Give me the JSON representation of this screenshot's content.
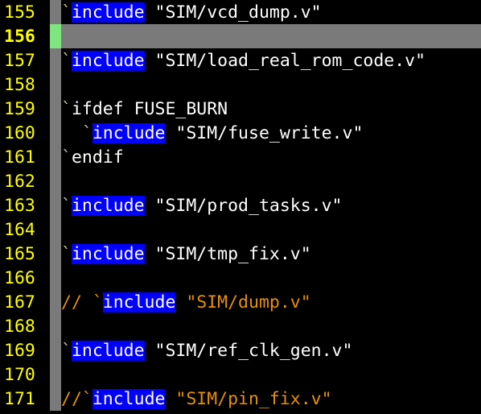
{
  "editor": {
    "lines": [
      {
        "num": "155",
        "segments": [
          {
            "t": "`",
            "c": "tick"
          },
          {
            "t": "include",
            "c": "kw-hl"
          },
          {
            "t": " \"SIM/vcd_dump.v\"",
            "c": "str"
          }
        ]
      },
      {
        "num": "156",
        "current": true,
        "segments": []
      },
      {
        "num": "157",
        "segments": [
          {
            "t": "`",
            "c": "tick"
          },
          {
            "t": "include",
            "c": "kw-hl"
          },
          {
            "t": " \"SIM/load_real_rom_code.v\"",
            "c": "str"
          }
        ]
      },
      {
        "num": "158",
        "segments": []
      },
      {
        "num": "159",
        "segments": [
          {
            "t": "`",
            "c": "tick"
          },
          {
            "t": "ifdef FUSE_BURN",
            "c": "str"
          }
        ]
      },
      {
        "num": "160",
        "segments": [
          {
            "t": "  `",
            "c": "tick"
          },
          {
            "t": "include",
            "c": "kw-hl"
          },
          {
            "t": " \"SIM/fuse_write.v\"",
            "c": "str"
          }
        ]
      },
      {
        "num": "161",
        "segments": [
          {
            "t": "`",
            "c": "tick"
          },
          {
            "t": "endif",
            "c": "str"
          }
        ]
      },
      {
        "num": "162",
        "segments": []
      },
      {
        "num": "163",
        "segments": [
          {
            "t": "`",
            "c": "tick"
          },
          {
            "t": "include",
            "c": "kw-hl"
          },
          {
            "t": " \"SIM/prod_tasks.v\"",
            "c": "str"
          }
        ]
      },
      {
        "num": "164",
        "segments": []
      },
      {
        "num": "165",
        "segments": [
          {
            "t": "`",
            "c": "tick"
          },
          {
            "t": "include",
            "c": "kw-hl"
          },
          {
            "t": " \"SIM/tmp_fix.v\"",
            "c": "str"
          }
        ]
      },
      {
        "num": "166",
        "segments": []
      },
      {
        "num": "167",
        "comment": true,
        "segments": [
          {
            "t": "// `",
            "c": "cmt"
          },
          {
            "t": "include",
            "c": "kw-hl"
          },
          {
            "t": " \"SIM/dump.v\"",
            "c": "cmt"
          }
        ]
      },
      {
        "num": "168",
        "segments": []
      },
      {
        "num": "169",
        "segments": [
          {
            "t": "`",
            "c": "tick"
          },
          {
            "t": "include",
            "c": "kw-hl"
          },
          {
            "t": " \"SIM/ref_clk_gen.v\"",
            "c": "str"
          }
        ]
      },
      {
        "num": "170",
        "segments": []
      },
      {
        "num": "171",
        "comment": true,
        "segments": [
          {
            "t": "//`",
            "c": "cmt"
          },
          {
            "t": "include",
            "c": "kw-hl"
          },
          {
            "t": " \"SIM/pin_fix.v\"",
            "c": "cmt"
          }
        ]
      }
    ]
  },
  "colors": {
    "background": "#000000",
    "line_number": "#ffff00",
    "keyword_highlight": "#0000ff",
    "comment": "#e8900a",
    "fold_column": "#7a7a7a",
    "cursor_line": "#7a7a7a",
    "cursor_marker": "#7fe57f"
  }
}
